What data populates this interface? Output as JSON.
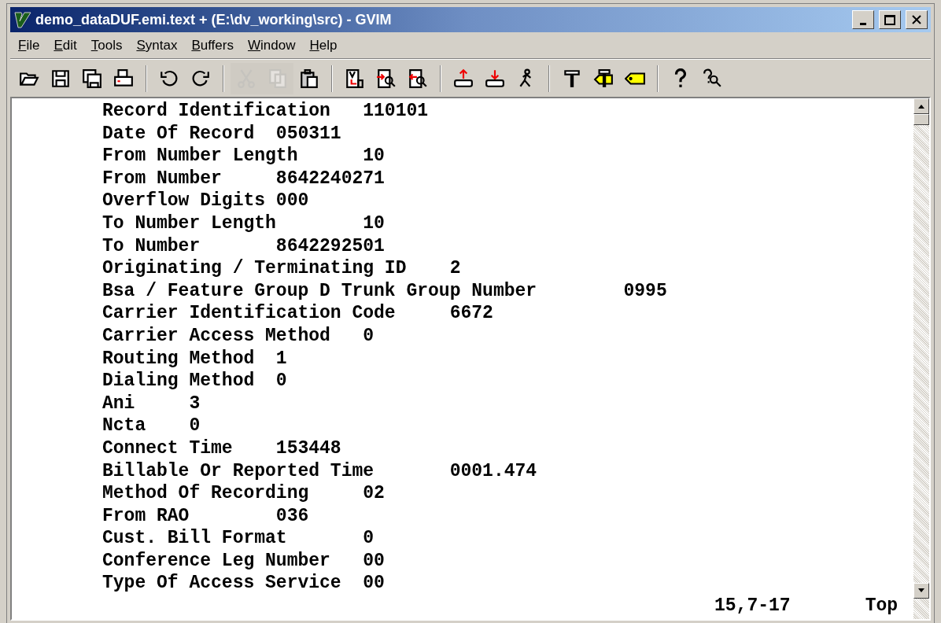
{
  "window": {
    "title": "demo_dataDUF.emi.text + (E:\\dv_working\\src) - GVIM"
  },
  "menu": [
    "File",
    "Edit",
    "Tools",
    "Syntax",
    "Buffers",
    "Window",
    "Help"
  ],
  "toolbar": [
    {
      "kind": "open",
      "disabled": false
    },
    {
      "kind": "save",
      "disabled": false
    },
    {
      "kind": "saveall",
      "disabled": false
    },
    {
      "kind": "print",
      "disabled": false
    },
    {
      "kind": "separator"
    },
    {
      "kind": "undo",
      "disabled": false
    },
    {
      "kind": "redo",
      "disabled": false
    },
    {
      "kind": "separator"
    },
    {
      "kind": "cut",
      "disabled": true
    },
    {
      "kind": "copy",
      "disabled": true
    },
    {
      "kind": "paste",
      "disabled": false
    },
    {
      "kind": "separator"
    },
    {
      "kind": "replace",
      "disabled": false
    },
    {
      "kind": "findnext",
      "disabled": false
    },
    {
      "kind": "findprev",
      "disabled": false
    },
    {
      "kind": "separator"
    },
    {
      "kind": "loadsession",
      "disabled": false
    },
    {
      "kind": "savesession",
      "disabled": false
    },
    {
      "kind": "script",
      "disabled": false
    },
    {
      "kind": "separator"
    },
    {
      "kind": "make",
      "disabled": false
    },
    {
      "kind": "maketags",
      "disabled": false
    },
    {
      "kind": "tag",
      "disabled": false
    },
    {
      "kind": "separator"
    },
    {
      "kind": "help",
      "disabled": false
    },
    {
      "kind": "findhelp",
      "disabled": false
    }
  ],
  "lines": [
    {
      "field": "Record Identification",
      "value": "110101"
    },
    {
      "field": "Date Of Record",
      "value": "050311"
    },
    {
      "field": "From Number Length",
      "value": "10"
    },
    {
      "field": "From Number",
      "value": "8642240271"
    },
    {
      "field": "Overflow Digits",
      "value": "000"
    },
    {
      "field": "To Number Length",
      "value": "10"
    },
    {
      "field": "To Number",
      "value": "8642292501"
    },
    {
      "field": "Originating / Terminating ID",
      "value": "2"
    },
    {
      "field": "Bsa / Feature Group D Trunk Group Number",
      "value": "0995"
    },
    {
      "field": "Carrier Identification Code",
      "value": "6672"
    },
    {
      "field": "Carrier Access Method",
      "value": "0"
    },
    {
      "field": "Routing Method",
      "value": "1"
    },
    {
      "field": "Dialing Method",
      "value": "0"
    },
    {
      "field": "Ani",
      "value": "3"
    },
    {
      "field": "Ncta",
      "value": "0"
    },
    {
      "field": "Connect Time",
      "value": "153448"
    },
    {
      "field": "Billable Or Reported Time",
      "value": "0001.474"
    },
    {
      "field": "Method Of Recording",
      "value": "02"
    },
    {
      "field": "From RAO",
      "value": "036"
    },
    {
      "field": "Cust. Bill Format",
      "value": "0"
    },
    {
      "field": "Conference Leg Number",
      "value": "00"
    },
    {
      "field": "Type Of Access Service",
      "value": "00"
    }
  ],
  "status": {
    "position": "15,7-17",
    "scroll": "Top"
  }
}
